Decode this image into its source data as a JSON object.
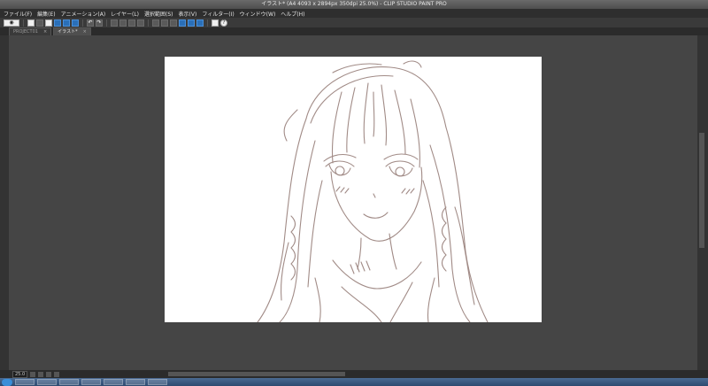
{
  "window": {
    "title": "イラスト* (A4 4093 x 2894px 350dpi 25.0%) - CLIP STUDIO PAINT PRO"
  },
  "menu": {
    "items": [
      {
        "label": "ファイル(F)"
      },
      {
        "label": "編集(E)"
      },
      {
        "label": "アニメーション(A)"
      },
      {
        "label": "レイヤー(L)"
      },
      {
        "label": "選択範囲(S)"
      },
      {
        "label": "表示(V)"
      },
      {
        "label": "フィルター(I)"
      },
      {
        "label": "ウィンドウ(W)"
      },
      {
        "label": "ヘルプ(H)"
      }
    ]
  },
  "tabs": [
    {
      "label": "PROJECT01",
      "close": "×"
    },
    {
      "label": "イラスト*",
      "close": "×"
    }
  ],
  "toolbar": {
    "help_glyph": "?"
  },
  "status": {
    "zoom": "25.0"
  },
  "colors": {
    "line_art": "#9c8580",
    "canvas": "#ffffff",
    "workspace": "#454545"
  }
}
